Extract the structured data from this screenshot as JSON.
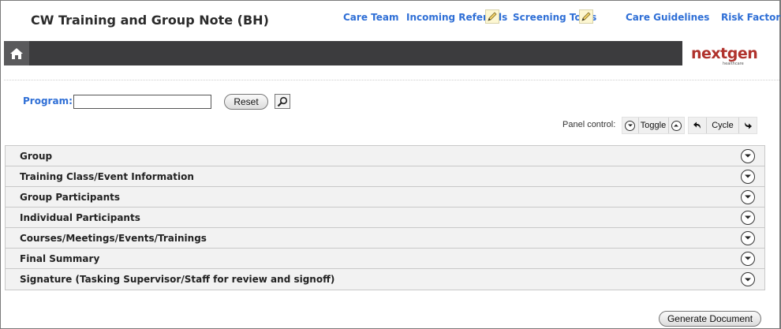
{
  "header": {
    "title": "CW Training and Group Note (BH)",
    "links": {
      "care_team": "Care Team",
      "incoming_referrals": "Incoming Referrals",
      "screening_tools": "Screening Tools",
      "care_guidelines": "Care Guidelines",
      "risk_factors": "Risk Factors"
    }
  },
  "logo": {
    "part1": "next",
    "part2": "gen",
    "subtext": "healthcare"
  },
  "search": {
    "program_label": "Program:",
    "program_value": "",
    "reset_label": "Reset"
  },
  "panel_control": {
    "label": "Panel control:",
    "toggle_label": "Toggle",
    "cycle_label": "Cycle"
  },
  "panels": [
    {
      "title": "Group"
    },
    {
      "title": "Training Class/Event Information"
    },
    {
      "title": "Group Participants"
    },
    {
      "title": "Individual Participants"
    },
    {
      "title": "Courses/Meetings/Events/Trainings"
    },
    {
      "title": "Final Summary"
    },
    {
      "title": "Signature (Tasking Supervisor/Staff for review and signoff)"
    }
  ],
  "footer": {
    "generate_label": "Generate Document"
  },
  "colors": {
    "link": "#2f6fd6",
    "banner": "#3c3c3e",
    "logo": "#b0322c",
    "panel_bg": "#f2f2f2"
  }
}
